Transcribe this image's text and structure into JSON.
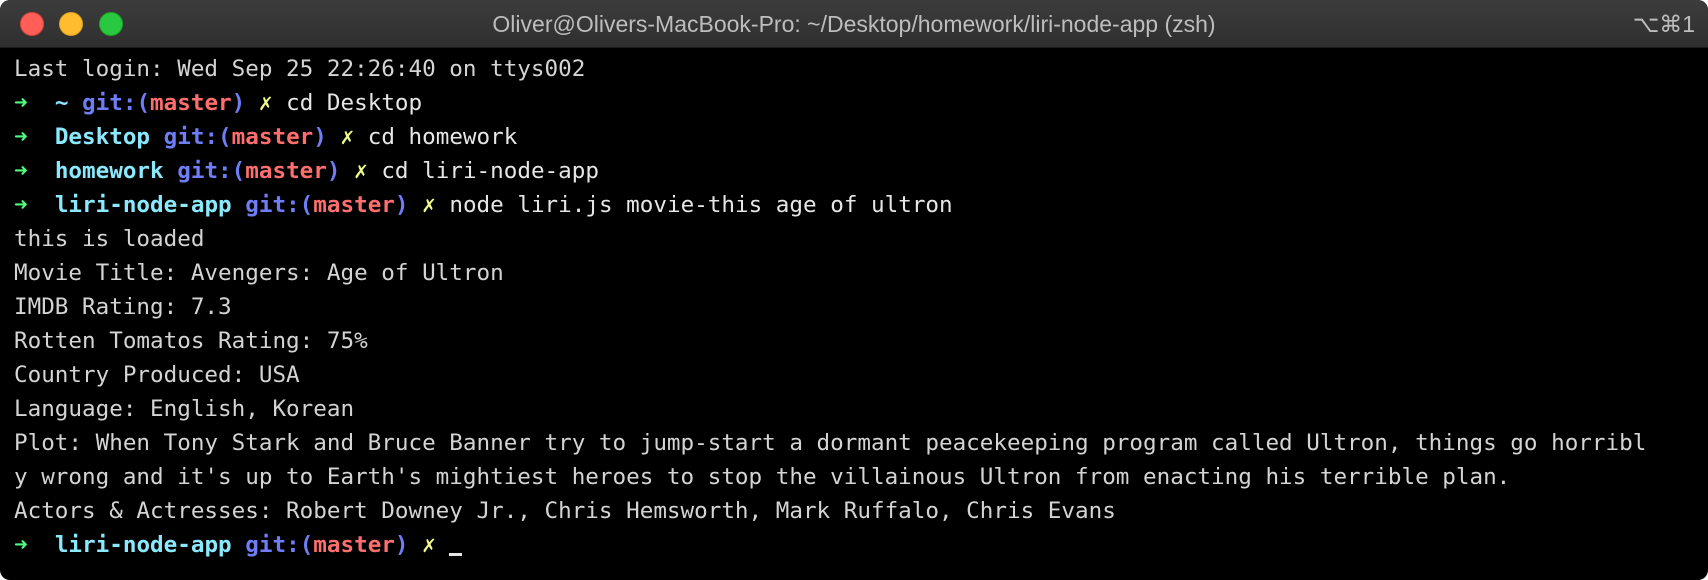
{
  "window": {
    "title": "Oliver@Olivers-MacBook-Pro: ~/Desktop/homework/liri-node-app (zsh)",
    "shortcut": "⌥⌘1"
  },
  "colors": {
    "prompt_arrow": "#50fa7b",
    "directory": "#8be9fd",
    "git_label": "#6f7df7",
    "branch": "#ff6e6e",
    "dirty_mark": "#f1fa8c",
    "text": "#d4d4d4",
    "background": "#000000"
  },
  "terminal": {
    "last_login": "Last login: Wed Sep 25 22:26:40 on ttys002",
    "prompts": [
      {
        "dir": "~",
        "git": "git:(",
        "branch": "master",
        "git_close": ")",
        "dirty": "✗",
        "command": "cd Desktop"
      },
      {
        "dir": "Desktop",
        "git": "git:(",
        "branch": "master",
        "git_close": ")",
        "dirty": "✗",
        "command": "cd homework"
      },
      {
        "dir": "homework",
        "git": "git:(",
        "branch": "master",
        "git_close": ")",
        "dirty": "✗",
        "command": "cd liri-node-app"
      },
      {
        "dir": "liri-node-app",
        "git": "git:(",
        "branch": "master",
        "git_close": ")",
        "dirty": "✗",
        "command": "node liri.js movie-this age of ultron"
      }
    ],
    "output": [
      "this is loaded",
      "Movie Title: Avengers: Age of Ultron",
      "IMDB Rating: 7.3",
      "Rotten Tomatos Rating: 75%",
      "Country Produced: USA",
      "Language: English, Korean",
      "Plot: When Tony Stark and Bruce Banner try to jump-start a dormant peacekeeping program called Ultron, things go horribl",
      "y wrong and it's up to Earth's mightiest heroes to stop the villainous Ultron from enacting his terrible plan.",
      "Actors & Actresses: Robert Downey Jr., Chris Hemsworth, Mark Ruffalo, Chris Evans"
    ],
    "current_prompt": {
      "arrow": "➜",
      "dir": "liri-node-app",
      "git": "git:(",
      "branch": "master",
      "git_close": ")",
      "dirty": "✗"
    }
  }
}
